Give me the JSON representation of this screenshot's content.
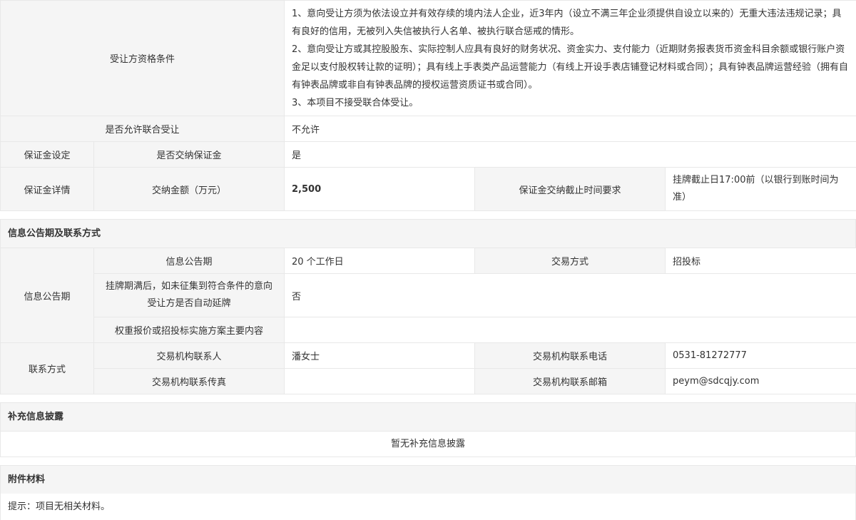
{
  "qualification": {
    "label": "受让方资格条件",
    "lines": [
      "1、意向受让方须为依法设立并有效存续的境内法人企业，近3年内（设立不满三年企业须提供自设立以来的）无重大违法违规记录；具有良好的信用，无被列入失信被执行人名单、被执行联合惩戒的情形。",
      "2、意向受让方或其控股股东、实际控制人应具有良好的财务状况、资金实力、支付能力（近期财务报表货币资金科目余额或银行账户资金足以支付股权转让款的证明）；具有线上手表类产品运营能力（有线上开设手表店铺登记材料或合同）；具有钟表品牌运营经验（拥有自有钟表品牌或非自有钟表品牌的授权运营资质证书或合同）。",
      "3、本项目不接受联合体受让。"
    ]
  },
  "joint": {
    "label": "是否允许联合受让",
    "value": "不允许"
  },
  "deposit_setting": {
    "group_label": "保证金设定",
    "label": "是否交纳保证金",
    "value": "是"
  },
  "deposit_detail": {
    "group_label": "保证金详情",
    "amount_label": "交纳金额（万元）",
    "amount_value": "2,500",
    "deadline_label": "保证金交纳截止时间要求",
    "deadline_value": "挂牌截止日17:00前（以银行到账时间为准）"
  },
  "info_section": {
    "title": "信息公告期及联系方式",
    "period_group_label": "信息公告期",
    "period_label": "信息公告期",
    "period_value": "20 个工作日",
    "trade_method_label": "交易方式",
    "trade_method_value": "招投标",
    "extend_label": "挂牌期满后，如未征集到符合条件的意向受让方是否自动延牌",
    "extend_value": "否",
    "scheme_label": "权重报价或招投标实施方案主要内容",
    "scheme_value": "",
    "contact_group_label": "联系方式",
    "contact_person_label": "交易机构联系人",
    "contact_person_value": "潘女士",
    "phone_label": "交易机构联系电话",
    "phone_value": "0531-81272777",
    "fax_label": "交易机构联系传真",
    "fax_value": "",
    "email_label": "交易机构联系邮箱",
    "email_value": "peym@sdcqjy.com"
  },
  "supplement": {
    "title": "补充信息披露",
    "text": "暂无补充信息披露"
  },
  "attachments": {
    "title": "附件材料",
    "tip": "提示：项目无相关材料。"
  }
}
